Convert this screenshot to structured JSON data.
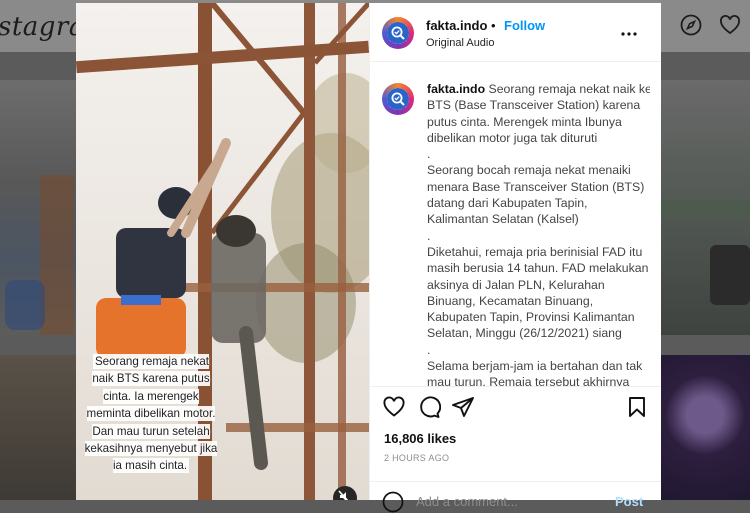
{
  "background": {
    "logo_text": "stagram"
  },
  "post": {
    "username": "fakta.indo",
    "follow_label": "Follow",
    "audio_label": "Original Audio",
    "caption_username": "fakta.indo",
    "caption": "Seorang remaja nekat naik ke BTS (Base Transceiver Station) karena putus cinta. Merengek minta Ibunya dibelikan motor juga tak dituruti\n.\nSeorang bocah remaja nekat menaiki menara Base Transceiver Station (BTS) datang dari Kabupaten Tapin, Kalimantan Selatan (Kalsel)\n.\nDiketahui, remaja pria berinisial FAD itu masih berusia 14 tahun. FAD melakukan aksinya di Jalan PLN, Kelurahan Binuang, Kecamatan Binuang, Kabupaten Tapin, Provinsi Kalimantan Selatan, Minggu (26/12/2021) siang\n.\nSelama berjam-jam ia bertahan dan tak mau turun. Remaja tersebut akhirnya",
    "likes": "16,806 likes",
    "timestamp": "2 HOURS AGO",
    "comment_placeholder": "Add a comment...",
    "post_label": "Post"
  },
  "video": {
    "caption_lines": "Seorang remaja nekat\nnaik BTS karena putus\ncinta. Ia merengek\nmeminta dibelikan motor.\nDan mau turun setelah\nkekasihnya menyebut jika\nia masih cinta."
  },
  "colors": {
    "accent": "#0095f6",
    "modal_bg": "#ffffff",
    "overlay": "#5b5b5b"
  }
}
